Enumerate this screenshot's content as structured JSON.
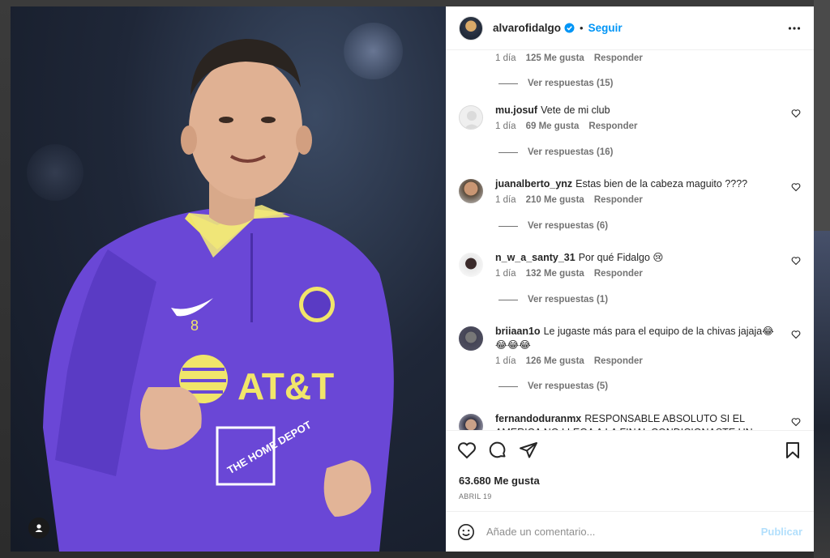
{
  "header": {
    "username": "alvarofidalgo",
    "separator": "•",
    "follow_label": "Seguir"
  },
  "media": {
    "jersey_brand_text": "AT&T",
    "sponsor_text": "THE HOME DEPOT",
    "jersey_number": "8"
  },
  "comments": [
    {
      "username": "",
      "text": "",
      "time": "1 día",
      "likes": "125 Me gusta",
      "reply_label": "Responder",
      "view_replies": "Ver respuestas (15)"
    },
    {
      "username": "mu.josuf",
      "text": "Vete de mi club",
      "time": "1 día",
      "likes": "69 Me gusta",
      "reply_label": "Responder",
      "view_replies": "Ver respuestas (16)"
    },
    {
      "username": "juanalberto_ynz",
      "text": "Estas bien de la cabeza maguito ????",
      "time": "1 día",
      "likes": "210 Me gusta",
      "reply_label": "Responder",
      "view_replies": "Ver respuestas (6)"
    },
    {
      "username": "n_w_a_santy_31",
      "text": "Por qué Fidalgo 😢",
      "time": "1 día",
      "likes": "132 Me gusta",
      "reply_label": "Responder",
      "view_replies": "Ver respuestas (1)"
    },
    {
      "username": "briiaan1o",
      "text": "Le jugaste más para el equipo de la chivas jajaja😂 😂😂😂",
      "time": "1 día",
      "likes": "126 Me gusta",
      "reply_label": "Responder",
      "view_replies": "Ver respuestas (5)"
    },
    {
      "username": "fernandoduranmx",
      "text": "RESPONSABLE ABSOLUTO SI EL AMERICA NO LLEGA A LA FINAL CONDICIONASTE UN PARTIDO QUE SE",
      "time": "",
      "likes": "",
      "reply_label": "",
      "view_replies": ""
    }
  ],
  "post": {
    "likes_count": "63.680 Me gusta",
    "date": "ABRIL 19"
  },
  "add_comment": {
    "placeholder": "Añade un comentario...",
    "publish_label": "Publicar"
  },
  "icons": {
    "verified": "verified-badge-icon",
    "more": "more-options-icon",
    "like": "heart-icon",
    "comment": "comment-icon",
    "share": "share-icon",
    "save": "bookmark-icon",
    "emoji": "emoji-icon",
    "user_tag": "user-tag-icon"
  },
  "colors": {
    "link_blue": "#0095f6",
    "publish_disabled": "#b2dffc",
    "jersey_purple": "#6a47d6",
    "jersey_yellow": "#f1e56a",
    "muted_text": "#737373"
  }
}
